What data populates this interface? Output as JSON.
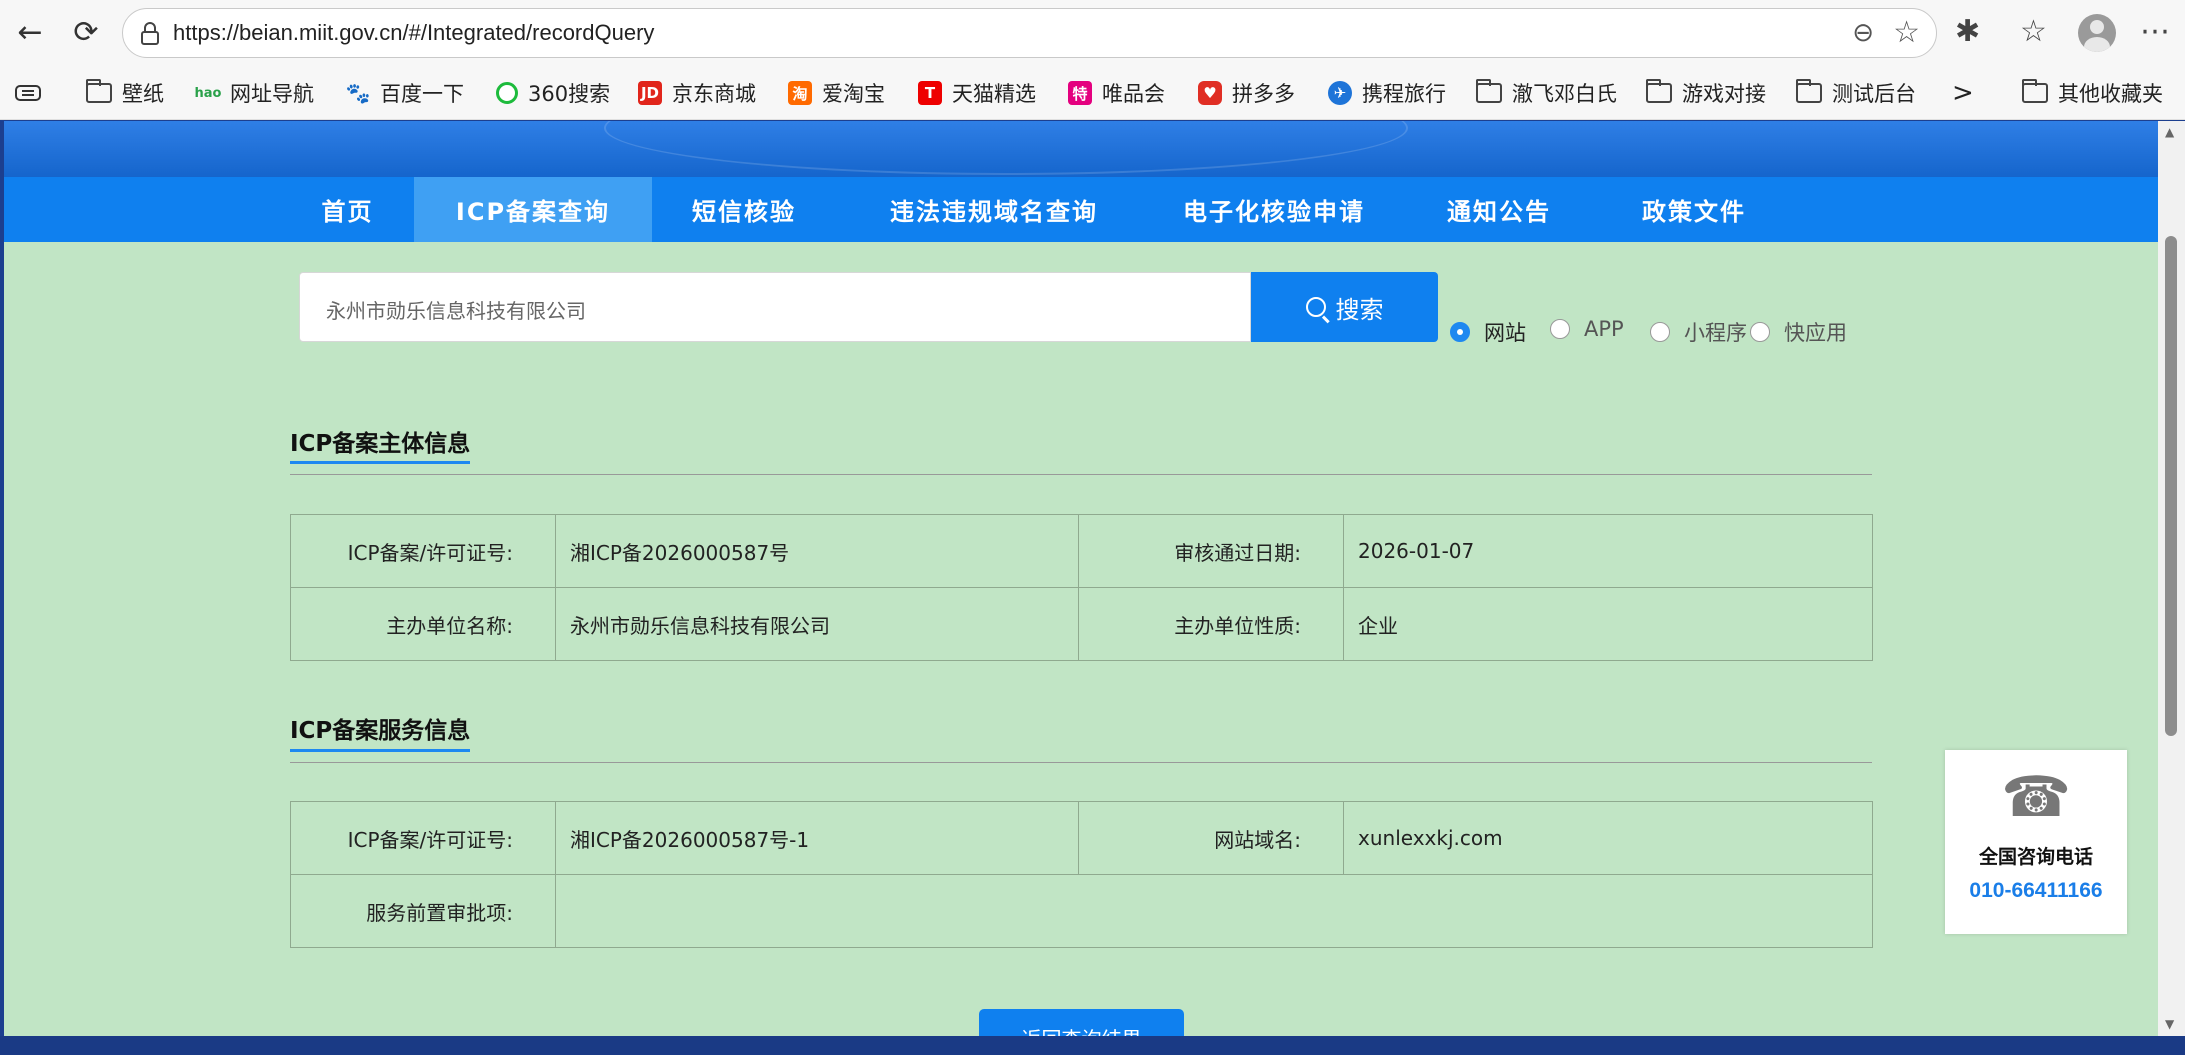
{
  "browser": {
    "url": "https://beian.miit.gov.cn/#/Integrated/recordQuery",
    "back_icon": "←",
    "reload_icon": "⟳",
    "zoom_icon": "⊖",
    "star_icon": "☆",
    "extensions_icon": "✱",
    "favorites_icon": "☆",
    "menu_icon": "⋯"
  },
  "bookmarks": {
    "items": [
      {
        "label": "壁纸",
        "icon": "folder"
      },
      {
        "label": "网址导航",
        "icon": "hao"
      },
      {
        "label": "百度一下",
        "icon": "baidu"
      },
      {
        "label": "360搜索",
        "icon": "360"
      },
      {
        "label": "京东商城",
        "icon": "JD"
      },
      {
        "label": "爱淘宝",
        "icon": "淘"
      },
      {
        "label": "天猫精选",
        "icon": "T"
      },
      {
        "label": "唯品会",
        "icon": "特"
      },
      {
        "label": "拼多多",
        "icon": "pdd"
      },
      {
        "label": "携程旅行",
        "icon": "ctrip"
      },
      {
        "label": "澈飞邓白氏",
        "icon": "folder"
      },
      {
        "label": "游戏对接",
        "icon": "folder"
      },
      {
        "label": "测试后台",
        "icon": "folder"
      },
      {
        "label": "其他收藏夹",
        "icon": "folder"
      }
    ],
    "more_icon": ">"
  },
  "nav": {
    "items": [
      "首页",
      "ICP备案查询",
      "短信核验",
      "违法违规域名查询",
      "电子化核验申请",
      "通知公告",
      "政策文件"
    ],
    "active": "ICP备案查询"
  },
  "search": {
    "value": "永州市勋乐信息科技有限公司",
    "button_label": "搜索",
    "options": [
      "网站",
      "APP",
      "小程序",
      "快应用"
    ],
    "selected": "网站"
  },
  "subject_info": {
    "title": "ICP备案主体信息",
    "license_label": "ICP备案/许可证号:",
    "license_value": "湘ICP备2026000587号",
    "approve_date_label": "审核通过日期:",
    "approve_date_value": "2026-01-07",
    "org_name_label": "主办单位名称:",
    "org_name_value": "永州市勋乐信息科技有限公司",
    "org_type_label": "主办单位性质:",
    "org_type_value": "企业"
  },
  "service_info": {
    "title": "ICP备案服务信息",
    "license_label": "ICP备案/许可证号:",
    "license_value": "湘ICP备2026000587号-1",
    "domain_label": "网站域名:",
    "domain_value": "xunlexxkj.com",
    "prior_approval_label": "服务前置审批项:",
    "prior_approval_value": ""
  },
  "back_button": "返回查询结果",
  "consult": {
    "label": "全国咨询电话",
    "phone": "010-66411166",
    "icon": "☎"
  }
}
